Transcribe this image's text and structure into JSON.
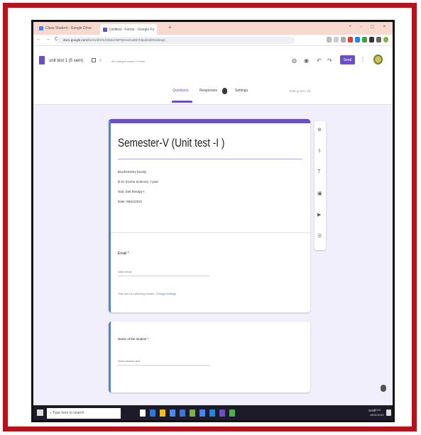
{
  "browser": {
    "tabs": [
      {
        "label": "Class Student - Google Drive",
        "icon": "drive-icon",
        "color": "#4285f4"
      },
      {
        "label": "Untitled - Forms - Google Fo",
        "icon": "forms-icon",
        "color": "#6a4fc7"
      }
    ],
    "new_tab": "+",
    "window_controls": "˅ – ▢ ✕",
    "nav": "← → C",
    "url_prefix": "docs.google.com",
    "url_rest": "/forms/d/1hLhSb6xXNPQKmZzaB5Yhkpd/edit#settings"
  },
  "form_header": {
    "doc_title": "unit test 1 (5 sem)",
    "save_note": "All changes saved in Drive",
    "send_label": "Send",
    "accent": "#6a4fc7"
  },
  "form_tabs": {
    "questions": "Questions",
    "responses": "Responses",
    "settings": "Settings",
    "total_points": "Total points: 20"
  },
  "form": {
    "title": "Semester-V (Unit test -I )",
    "description": [
      "Biochemistry faculty",
      "B.Sc (Home Science) -I year",
      "Sub: Diet therapy-I",
      "Date: 08/11/2021"
    ],
    "email_label": "Email *",
    "email_placeholder": "Valid email",
    "collect_note": "This form is collecting emails.",
    "collect_link": "Change settings"
  },
  "question2": {
    "label": "Name of the student *",
    "placeholder": "Short answer text"
  },
  "side_toolbar": [
    "add-question-icon",
    "import-icon",
    "title-icon",
    "image-icon",
    "video-icon",
    "section-icon"
  ],
  "taskbar": {
    "search_placeholder": "Type here to search",
    "tray_text": "ENG",
    "time": "10:24",
    "date": "08/11/2021",
    "app_colors": [
      "#ffffff",
      "#2b78e4",
      "#f4c20d",
      "#4a8af4",
      "#3c78d8",
      "#7cb342",
      "#4285f4",
      "#1e88e5",
      "#6a4fc7",
      "#4caf50"
    ]
  }
}
